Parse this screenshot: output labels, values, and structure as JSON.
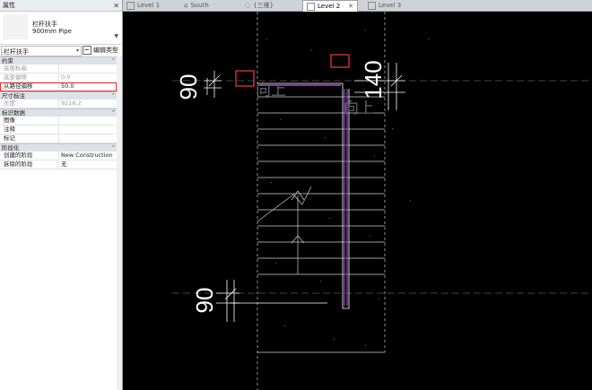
{
  "properties": {
    "title": "属性",
    "type_name": "栏杆扶手",
    "type_subname": "900mm Pipe",
    "selector_value": "栏杆扶手",
    "edit_type_label": "编辑类型",
    "sections": {
      "constraints": "约束",
      "dimensions": "尺寸标注",
      "identity": "标识数据",
      "phasing": "阶段化"
    },
    "rows": {
      "base_level": {
        "key": "底部标高",
        "value": ""
      },
      "base_offset": {
        "key": "底部偏移",
        "value": "0.0"
      },
      "offset_from_path": {
        "key": "从路径偏移",
        "value": "50.0"
      },
      "length": {
        "key": "长度",
        "value": "9218.2"
      },
      "image": {
        "key": "图像",
        "value": ""
      },
      "comments": {
        "key": "注释",
        "value": ""
      },
      "mark": {
        "key": "标记",
        "value": ""
      },
      "phase_created": {
        "key": "创建的阶段",
        "value": "New Construction"
      },
      "phase_demolished": {
        "key": "拆除的阶段",
        "value": "无"
      }
    }
  },
  "tabs": [
    {
      "label": "Level 1"
    },
    {
      "label": "South"
    },
    {
      "label": "{三维}"
    },
    {
      "label": "Level 2"
    },
    {
      "label": "Level 3"
    }
  ],
  "canvas": {
    "dim_left_top": "90",
    "dim_left_bottom": "90",
    "dim_right_top": "140",
    "text_up_1": "向上",
    "text_up_2": "向上"
  },
  "colors": {
    "background": "#000000",
    "highlight": "#d33333",
    "railing": "#7b3ea0"
  }
}
